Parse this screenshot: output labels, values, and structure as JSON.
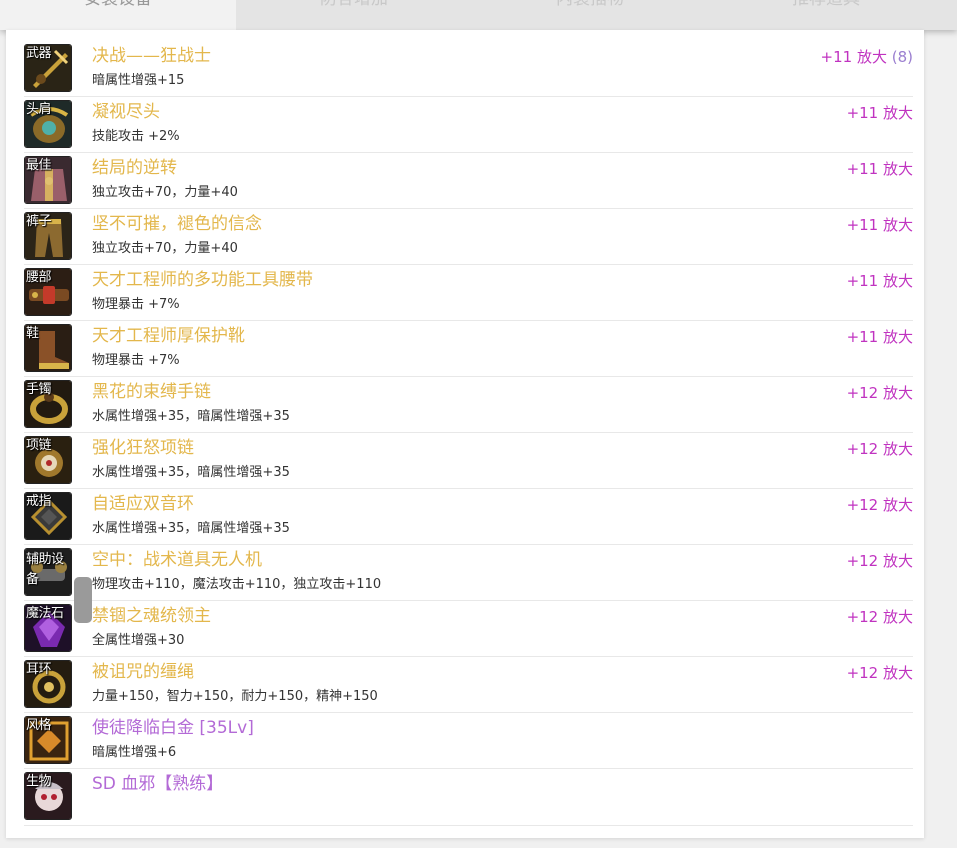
{
  "tabs": [
    {
      "label": "安装设备",
      "active": true
    },
    {
      "label": "防各增加",
      "active": false
    },
    {
      "label": "内装插物",
      "active": false
    },
    {
      "label": "推荐道具",
      "active": false
    }
  ],
  "colors": {
    "name_gold": "#e3b74c",
    "name_purple": "#b36ad6",
    "enhance": "#c033c0",
    "count": "#9b7fd0"
  },
  "items": [
    {
      "slot": "武器",
      "icon": "weapon-icon",
      "name": "决战——狂战士",
      "stats": "暗属性增强+15",
      "enhance": "+11 放大",
      "count": "(8)"
    },
    {
      "slot": "头肩",
      "icon": "shoulder-icon",
      "name": "凝视尽头",
      "stats": "技能攻击 +2%",
      "enhance": "+11 放大"
    },
    {
      "slot": "最佳",
      "icon": "top-icon",
      "name": "结局的逆转",
      "stats": "独立攻击+70，力量+40",
      "enhance": "+11 放大"
    },
    {
      "slot": "裤子",
      "icon": "pants-icon",
      "name": "坚不可摧，褪色的信念",
      "stats": "独立攻击+70，力量+40",
      "enhance": "+11 放大"
    },
    {
      "slot": "腰部",
      "icon": "belt-icon",
      "name": "天才工程师的多功能工具腰带",
      "stats": "物理暴击 +7%",
      "enhance": "+11 放大"
    },
    {
      "slot": "鞋",
      "icon": "shoes-icon",
      "name": "天才工程师厚保护靴",
      "stats": "物理暴击 +7%",
      "enhance": "+11 放大"
    },
    {
      "slot": "手镯",
      "icon": "bracelet-icon",
      "name": "黑花的束缚手链",
      "stats": "水属性增强+35，暗属性增强+35",
      "enhance": "+12 放大"
    },
    {
      "slot": "项链",
      "icon": "necklace-icon",
      "name": "强化狂怒项链",
      "stats": "水属性增强+35，暗属性增强+35",
      "enhance": "+12 放大"
    },
    {
      "slot": "戒指",
      "icon": "ring-icon",
      "name": "自适应双音环",
      "stats": "水属性增强+35，暗属性增强+35",
      "enhance": "+12 放大"
    },
    {
      "slot": "辅助设备",
      "icon": "drone-icon",
      "name": "空中：战术道具无人机",
      "stats": "物理攻击+110，魔法攻击+110，独立攻击+110",
      "enhance": "+12 放大"
    },
    {
      "slot": "魔法石",
      "icon": "magic-stone-icon",
      "name": "禁锢之魂统领主",
      "stats": "全属性增强+30",
      "enhance": "+12 放大"
    },
    {
      "slot": "耳环",
      "icon": "earring-icon",
      "name": "被诅咒的缰绳",
      "stats": "力量+150，智力+150，耐力+150，精神+150",
      "enhance": "+12 放大"
    },
    {
      "slot": "风格",
      "icon": "style-icon",
      "name": "使徒降临白金 [35Lv]",
      "stats": "暗属性增强+6",
      "enhance": ""
    },
    {
      "slot": "生物",
      "icon": "pet-icon",
      "name": "SD 血邪【熟练】",
      "stats": "",
      "enhance": ""
    }
  ]
}
